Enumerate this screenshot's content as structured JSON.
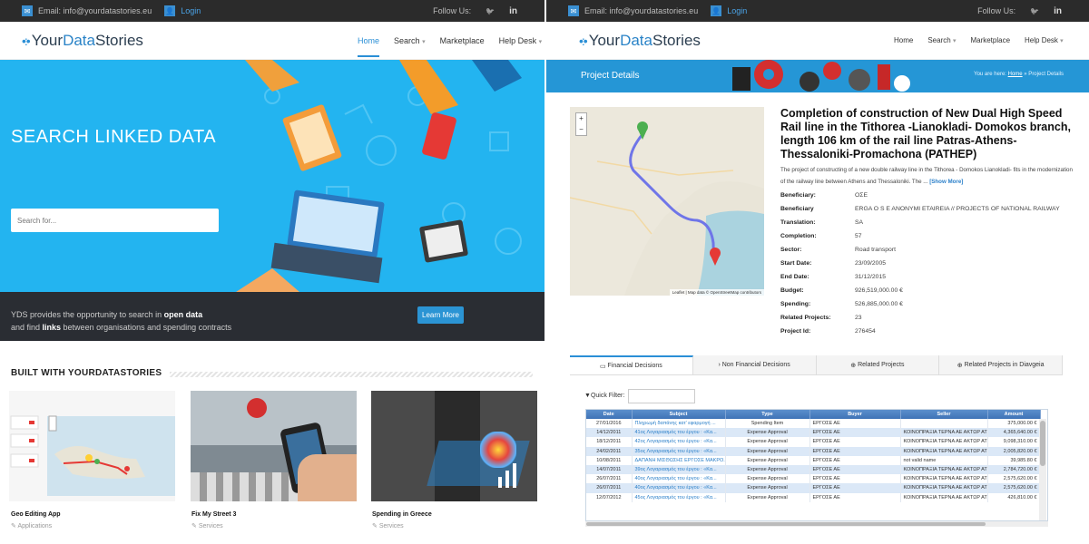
{
  "topbar": {
    "email": "Email: info@yourdatastories.eu",
    "login": "Login",
    "follow": "Follow Us:",
    "twitter": "🐦",
    "linkedin": "in"
  },
  "brand": {
    "prefix": "Your",
    "bold": "Data",
    "suffix": "Stories"
  },
  "nav": {
    "home": "Home",
    "search": "Search",
    "marketplace": "Marketplace",
    "helpdesk": "Help Desk"
  },
  "hero": {
    "title": "SEARCH LINKED DATA",
    "search_placeholder": "Search for...",
    "line1_pre": "YDS provides the opportunity to search in ",
    "line1_bold": "open data",
    "line2_pre": "and find ",
    "line2_bold": "links",
    "line2_post": " between organisations and spending contracts",
    "learn_more": "Learn More"
  },
  "built": {
    "heading": "BUILT WITH YOURDATASTORIES",
    "cards": [
      {
        "title": "Geo Editing App",
        "category": "Applications"
      },
      {
        "title": "Fix My Street 3",
        "category": "Services"
      },
      {
        "title": "Spending in Greece",
        "category": "Services"
      }
    ]
  },
  "details": {
    "band_title": "Project Details",
    "breadcrumb_pre": "You are here: ",
    "breadcrumb_home": "Home",
    "breadcrumb_current": " » Project Details",
    "map_attribution": "Leaflet | Map data © OpenStreetMap contributors",
    "title": "Completion of construction of New Dual High Speed Rail line in the Tithorea -Lianokladi- Domokos branch, length 106 km of the rail line Patras-Athens-Thessaloniki-Promachona (PATHEP)",
    "description": "The project of constructing of a new double railway line in the Tithorea - Domokos Lianokladi- fits in the modernization of the railway line between Athens and Thessaloniki. The ...",
    "show_more": "[Show More]",
    "fields": [
      {
        "k": "Beneficiary:",
        "v": "ΟΣΕ"
      },
      {
        "k": "Beneficiary",
        "v": "ERGA O S E ANONYMI ETAIREIA // PROJECTS OF NATIONAL RAILWAY"
      },
      {
        "k": "Translation:",
        "v": "SA"
      },
      {
        "k": "Completion:",
        "v": "57"
      },
      {
        "k": "Sector:",
        "v": "Road transport"
      },
      {
        "k": "Start Date:",
        "v": "23/09/2005"
      },
      {
        "k": "End Date:",
        "v": "31/12/2015"
      },
      {
        "k": "Budget:",
        "v": "926,519,000.00 €"
      },
      {
        "k": "Spending:",
        "v": "526,885,000.00 €"
      },
      {
        "k": "Related Projects:",
        "v": "23"
      },
      {
        "k": "Project Id:",
        "v": "276454"
      }
    ],
    "tabs": [
      "Financial Decisions",
      "Non Financial Decisions",
      "Related Projects",
      "Related Projects in Diavgeia"
    ],
    "quick_filter": "Quick Filter:",
    "columns": [
      "Date",
      "Subject",
      "Type",
      "Buyer",
      "Seller",
      "Amount"
    ],
    "rows": [
      [
        "27/01/2016",
        "Πληρωμή δαπάνης κατ' εφαρμογή ...",
        "Spending Item",
        "ΕΡΓΟΣΕ ΑΕ",
        "",
        "375,000.00 €"
      ],
      [
        "14/12/2011",
        "41ος Λογαριασμός του έργου : «Κα...",
        "Expense Approval",
        "ΕΡΓΟΣΕ ΑΕ",
        "ΚΟΙΝΟΠΡΑΞΙΑ ΤΕΡΝΑ ΑΕ ΑΚΤΩΡ ΑΤΕ...",
        "4,365,640.00 €"
      ],
      [
        "18/12/2011",
        "42ος Λογαριασμός του έργου : «Κα...",
        "Expense Approval",
        "ΕΡΓΟΣΕ ΑΕ",
        "ΚΟΙΝΟΠΡΑΞΙΑ ΤΕΡΝΑ ΑΕ ΑΚΤΩΡ ΑΤΕ...",
        "9,098,310.00 €"
      ],
      [
        "24/02/2011",
        "35ος Λογαριασμός του έργου : «Κα...",
        "Expense Approval",
        "ΕΡΓΟΣΕ ΑΕ",
        "ΚΟΙΝΟΠΡΑΞΙΑ ΤΕΡΝΑ ΑΕ ΑΚΤΩΡ ΑΤΕ...",
        "2,005,820.00 €"
      ],
      [
        "10/08/2011",
        "ΔΑΠΑΝΗ ΜΙΣΘΩΣΗΣ ΕΡΓΟΣΕ ΜΑΚΡΟ...",
        "Expense Approval",
        "ΕΡΓΟΣΕ ΑΕ",
        "not valid name",
        "39,985.80 €"
      ],
      [
        "14/07/2011",
        "39ος Λογαριασμός του έργου : «Κα...",
        "Expense Approval",
        "ΕΡΓΟΣΕ ΑΕ",
        "ΚΟΙΝΟΠΡΑΞΙΑ ΤΕΡΝΑ ΑΕ ΑΚΤΩΡ ΑΤΕ...",
        "2,784,720.00 €"
      ],
      [
        "26/07/2011",
        "40ος Λογαριασμός του έργου : «Κα...",
        "Expense Approval",
        "ΕΡΓΟΣΕ ΑΕ",
        "ΚΟΙΝΟΠΡΑΞΙΑ ΤΕΡΝΑ ΑΕ ΑΚΤΩΡ ΑΤΕ...",
        "2,575,620.00 €"
      ],
      [
        "26/07/2011",
        "40ος Λογαριασμός του έργου : «Κα...",
        "Expense Approval",
        "ΕΡΓΟΣΕ ΑΕ",
        "ΚΟΙΝΟΠΡΑΞΙΑ ΤΕΡΝΑ ΑΕ ΑΚΤΩΡ ΑΤΕ...",
        "2,575,620.00 €"
      ],
      [
        "12/07/2012",
        "45ος Λογαριασμός του έργου : «Κα...",
        "Expense Approval",
        "ΕΡΓΟΣΕ ΑΕ",
        "ΚΟΙΝΟΠΡΑΞΙΑ ΤΕΡΝΑ ΑΕ ΑΚΤΩΡ ΑΤΕ...",
        "426,810.00 €"
      ]
    ]
  },
  "colors": {
    "accent": "#2a8fd6",
    "hero": "#23b4f0",
    "dark": "#2b2b2b"
  }
}
